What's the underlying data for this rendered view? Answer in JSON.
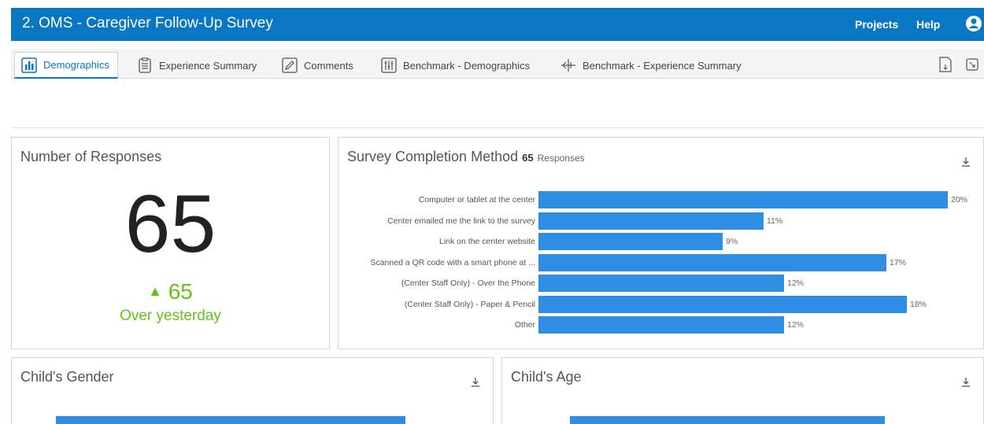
{
  "header": {
    "title": "2. OMS - Caregiver Follow-Up Survey",
    "links": [
      "Projects",
      "Help"
    ]
  },
  "tabs": [
    {
      "label": "Demographics",
      "icon": "bar-chart-icon",
      "active": true
    },
    {
      "label": "Experience Summary",
      "icon": "clipboard-icon",
      "active": false
    },
    {
      "label": "Comments",
      "icon": "pencil-icon",
      "active": false
    },
    {
      "label": "Benchmark - Demographics",
      "icon": "sliders-icon",
      "active": false
    },
    {
      "label": "Benchmark - Experience Summary",
      "icon": "benchmark-icon",
      "active": false
    }
  ],
  "responses_panel": {
    "title": "Number of Responses",
    "value": "65",
    "delta": "65",
    "delta_label": "Over yesterday"
  },
  "completion_panel": {
    "title": "Survey Completion Method",
    "count": "65",
    "count_suffix": "Responses"
  },
  "gender_panel": {
    "title": "Child's Gender"
  },
  "age_panel": {
    "title": "Child's Age"
  },
  "colors": {
    "brand": "#0a77c4",
    "bar": "#2f8de4",
    "positive": "#64c21d"
  },
  "chart_data": {
    "type": "bar",
    "orientation": "horizontal",
    "categories": [
      "Computer or tablet at the center",
      "Center emailed me the link to the survey",
      "Link on the center website",
      "Scanned a QR code with a smart phone at ...",
      "(Center Staff Only) - Over the Phone",
      "(Center Staff Only) - Paper & Pencil",
      "Other"
    ],
    "values": [
      20,
      11,
      9,
      17,
      12,
      18,
      12
    ],
    "labels": [
      "20%",
      "11%",
      "9%",
      "17%",
      "12%",
      "18%",
      "12%"
    ],
    "xlim": [
      0,
      20
    ],
    "grid": false
  }
}
